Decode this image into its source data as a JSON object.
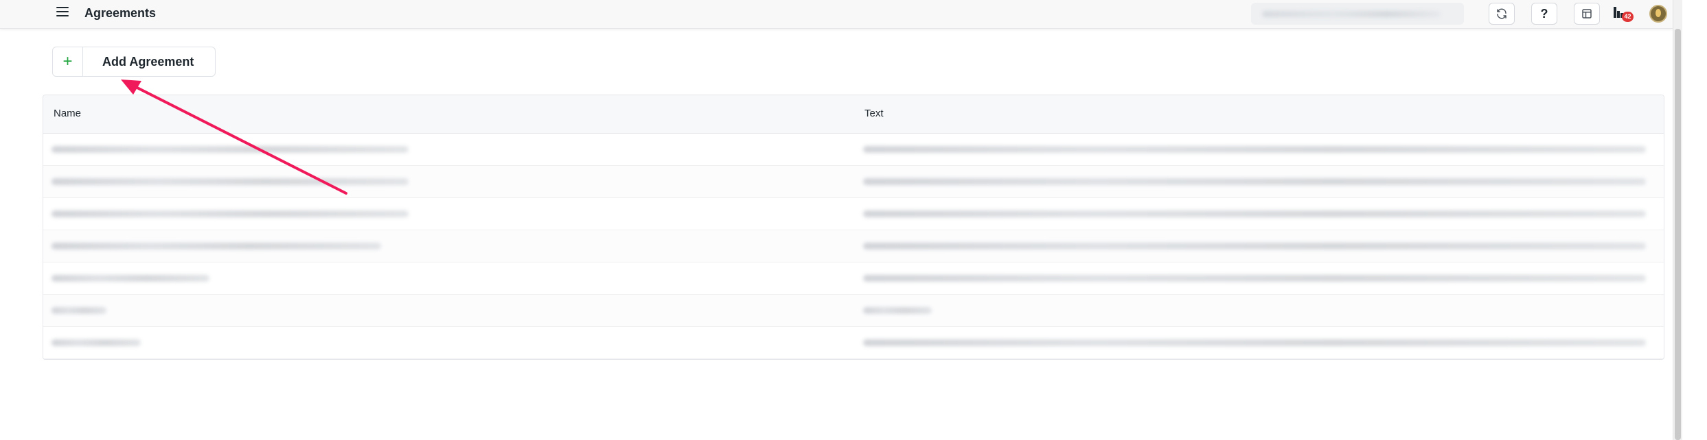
{
  "header": {
    "title": "Agreements",
    "icons": {
      "menu": "hamburger-menu-icon",
      "refresh": "refresh-icon",
      "help": "?",
      "panel": "panel-icon",
      "notifications": "notification-bars-icon"
    },
    "notification_count": "42",
    "colors": {
      "badge": "#e03636",
      "topbar": "#f8f8f9"
    }
  },
  "toolbar": {
    "add_button_icon": "+",
    "add_button_label": "Add Agreement",
    "accent": "#27a844"
  },
  "table": {
    "columns": [
      "Name",
      "Text"
    ],
    "rows": [
      {
        "name": "",
        "text": ""
      },
      {
        "name": "",
        "text": ""
      },
      {
        "name": "",
        "text": ""
      },
      {
        "name": "",
        "text": ""
      },
      {
        "name": "",
        "text": ""
      },
      {
        "name": "",
        "text": ""
      },
      {
        "name": "",
        "text": ""
      }
    ]
  },
  "annotation": {
    "arrow_color": "#f0195a"
  }
}
